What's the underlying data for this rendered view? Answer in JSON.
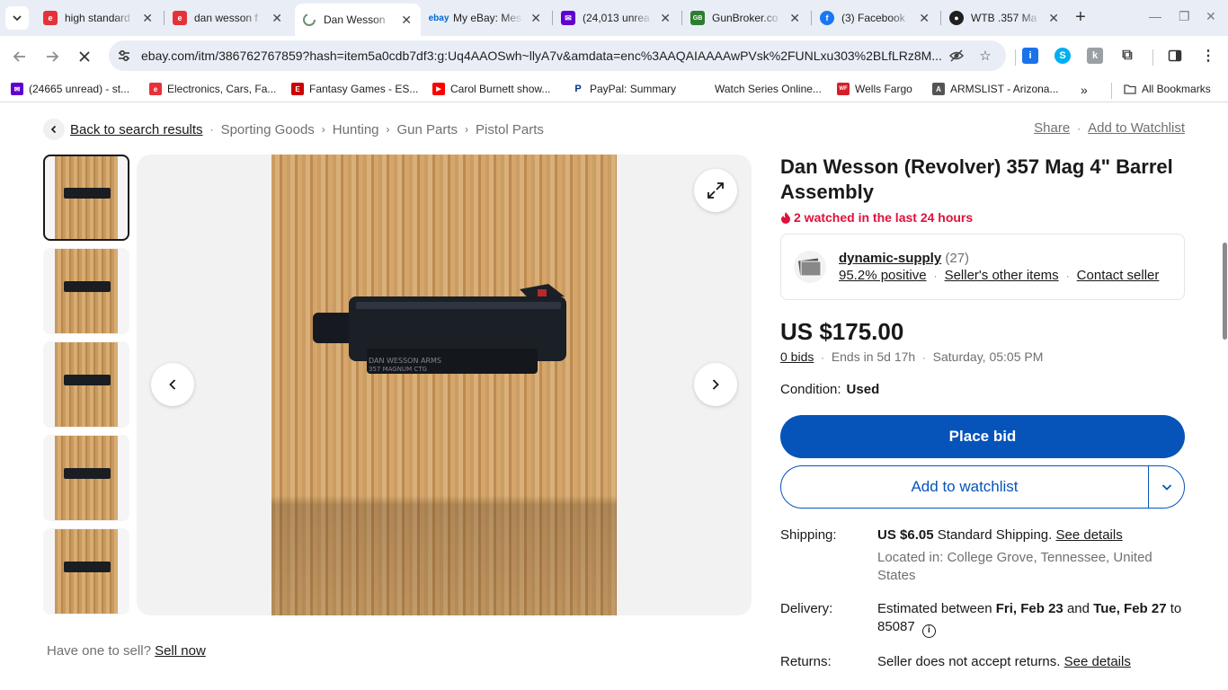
{
  "browser": {
    "tabs": [
      {
        "title": "high standard",
        "favicon": "ebay-bag-icon",
        "color": "#e53238"
      },
      {
        "title": "dan wesson f",
        "favicon": "ebay-bag-icon",
        "color": "#e53238"
      },
      {
        "title": "Dan Wesson",
        "favicon": "loading-spinner-icon",
        "color": "#6b8f71",
        "active": true
      },
      {
        "title": "My eBay: Mes",
        "favicon": "ebay-logo-icon",
        "color": "#0064d2"
      },
      {
        "title": "(24,013 unrea",
        "favicon": "yahoo-mail-icon",
        "color": "#6001d2"
      },
      {
        "title": "GunBroker.co",
        "favicon": "gunbroker-icon",
        "color": "#2f7d32"
      },
      {
        "title": "(3) Facebook",
        "favicon": "facebook-icon",
        "color": "#1877f2"
      },
      {
        "title": "WTB .357 Ma",
        "favicon": "site-icon",
        "color": "#202020"
      }
    ],
    "url": "ebay.com/itm/386762767859?hash=item5a0cdb7df3:g:Uq4AAOSwh~llyA7v&amdata=enc%3AAQAIAAAAwPVsk%2FUNLxu303%2BLfLRz8M...",
    "bookmarks": [
      {
        "label": "(24665 unread) - st...",
        "icon": "yahoo-mail-icon",
        "color": "#6001d2"
      },
      {
        "label": "Electronics, Cars, Fa...",
        "icon": "ebay-bag-icon",
        "color": "#e53238"
      },
      {
        "label": "Fantasy Games - ES...",
        "icon": "espn-icon",
        "color": "#cc0000"
      },
      {
        "label": "Carol Burnett show...",
        "icon": "youtube-icon",
        "color": "#ff0000"
      },
      {
        "label": "PayPal: Summary",
        "icon": "paypal-icon",
        "color": "#003087"
      },
      {
        "label": "Watch Series Online...",
        "icon": "blank-page-icon",
        "color": "#ffffff"
      },
      {
        "label": "Wells Fargo",
        "icon": "wells-fargo-icon",
        "color": "#d71e28"
      },
      {
        "label": "ARMSLIST - Arizona...",
        "icon": "armslist-icon",
        "color": "#555555"
      }
    ],
    "all_bookmarks_label": "All Bookmarks"
  },
  "breadcrumb": {
    "back_label": "Back to search results",
    "items": [
      "Sporting Goods",
      "Hunting",
      "Gun Parts",
      "Pistol Parts"
    ]
  },
  "top_actions": {
    "share": "Share",
    "watchlist": "Add to Watchlist"
  },
  "gallery": {
    "thumbnail_count": 5
  },
  "sell_prompt": {
    "text": "Have one to sell?",
    "link": "Sell now"
  },
  "listing": {
    "title": "Dan Wesson (Revolver) 357 Mag 4\" Barrel Assembly",
    "watch_note": "2 watched in the last 24 hours",
    "seller": {
      "name": "dynamic-supply",
      "feedback_count": "(27)",
      "positive": "95.2% positive",
      "other_items": "Seller's other items",
      "contact": "Contact seller"
    },
    "price": "US $175.00",
    "bids": "0 bids",
    "ends_in": "Ends in 5d 17h",
    "end_time": "Saturday, 05:05 PM",
    "condition_label": "Condition:",
    "condition_value": "Used",
    "place_bid": "Place bid",
    "add_watchlist": "Add to watchlist"
  },
  "shipping": {
    "label": "Shipping:",
    "cost": "US $6.05",
    "method": "Standard Shipping.",
    "details_link": "See details",
    "location": "Located in: College Grove, Tennessee, United States"
  },
  "delivery": {
    "label": "Delivery:",
    "prefix": "Estimated between",
    "from": "Fri, Feb 23",
    "and": "and",
    "to": "Tue, Feb 27",
    "suffix": "to",
    "zip": "85087"
  },
  "returns": {
    "label": "Returns:",
    "text": "Seller does not accept returns.",
    "link": "See details"
  }
}
